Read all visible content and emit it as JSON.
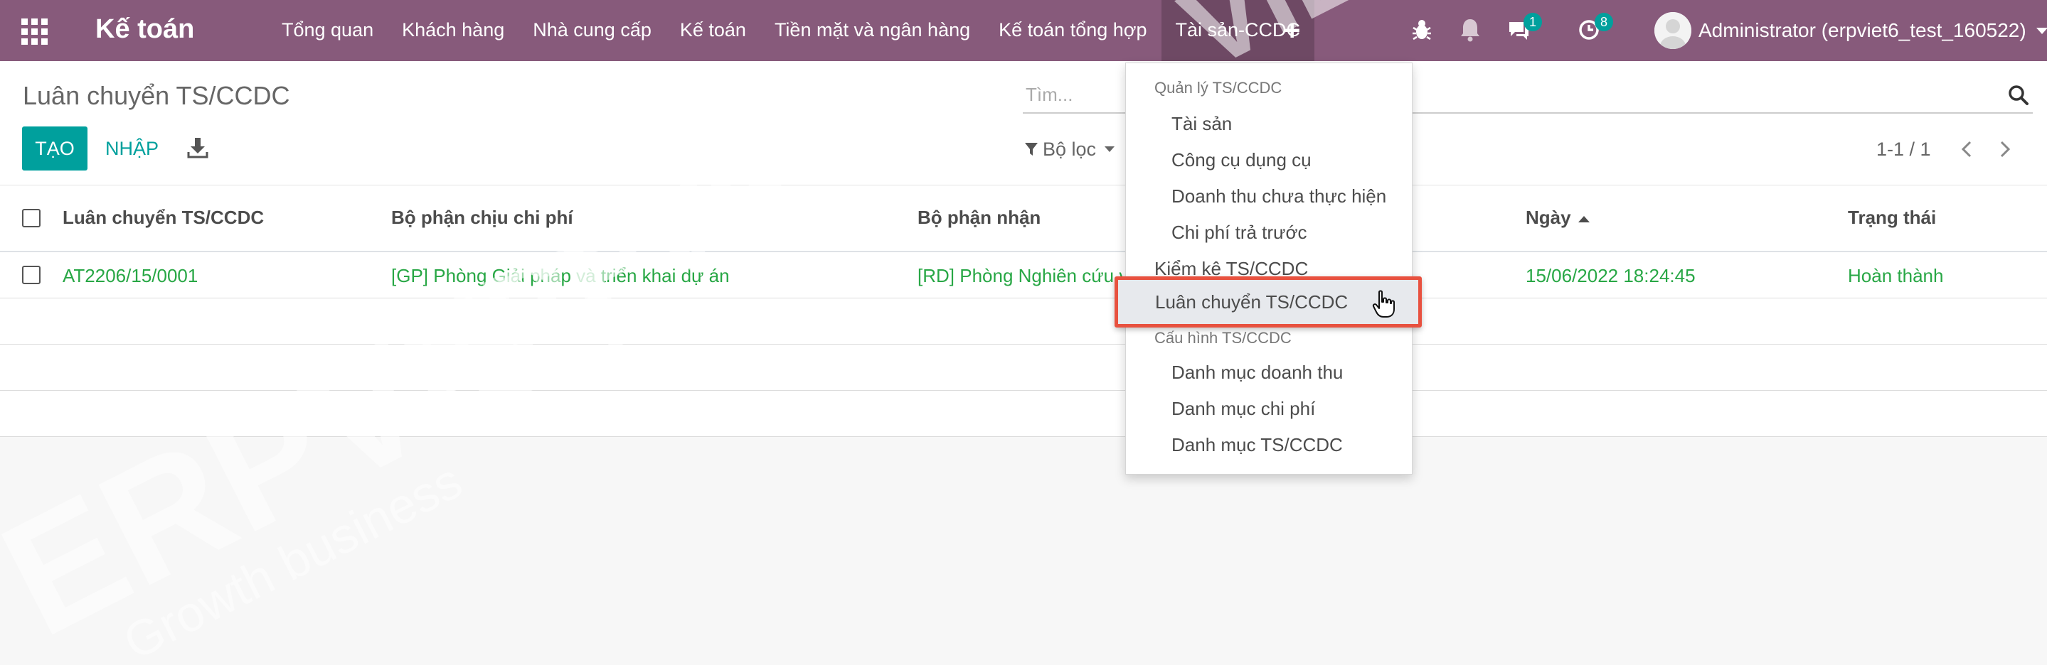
{
  "navbar": {
    "app_title": "Kế toán",
    "menu": [
      {
        "label": "Tổng quan"
      },
      {
        "label": "Khách hàng"
      },
      {
        "label": "Nhà cung cấp"
      },
      {
        "label": "Kế toán"
      },
      {
        "label": "Tiền mặt và ngân hàng"
      },
      {
        "label": "Kế toán tổng hợp"
      },
      {
        "label": "Tài sản-CCDC",
        "active": true
      }
    ],
    "messages_count": "1",
    "activities_count": "8",
    "user_name": "Administrator (erpviet6_test_160522)",
    "icons": [
      "apps-grid-icon",
      "plus-icon",
      "bug-icon",
      "bell-icon",
      "chat-icon",
      "clock-icon",
      "avatar"
    ]
  },
  "control_panel": {
    "breadcrumb": "Luân chuyển TS/CCDC",
    "search_placeholder": "Tìm...",
    "create_label": "TẠO",
    "import_label": "NHẬP",
    "filter_label": "Bộ lọc",
    "pager_value": "1-1 / 1"
  },
  "table": {
    "columns": [
      "Luân chuyển TS/CCDC",
      "Bộ phận chịu chi phí",
      "Bộ phận nhận",
      "Ngày",
      "Trạng thái"
    ],
    "sorted_column": "Ngày",
    "rows": [
      {
        "code": "AT2206/15/0001",
        "cost_department": "[GP] Phòng Giải pháp và triển khai dự án",
        "receiving_department": "[RD] Phòng Nghiên cứu và",
        "date": "15/06/2022 18:24:45",
        "status": "Hoàn thành"
      }
    ]
  },
  "dropdown": {
    "section1_header": "Quản lý TS/CCDC",
    "section1_items": [
      "Tài sản",
      "Công cụ dụng cụ",
      "Doanh thu chưa thực hiện",
      "Chi phí trả trước"
    ],
    "inventory_item": "Kiểm kê TS/CCDC",
    "highlighted_item": "Luân chuyển TS/CCDC",
    "section2_header": "Cấu hình TS/CCDC",
    "section2_items": [
      "Danh mục doanh thu",
      "Danh mục chi phí",
      "Danh mục TS/CCDC"
    ]
  },
  "watermark": {
    "brand": "ERPVIET",
    "tagline": "Growth business"
  },
  "colors": {
    "navbar": "#875a7b",
    "accent": "#00a09d",
    "link_green": "#28a745",
    "highlight_border": "#e8513f"
  }
}
